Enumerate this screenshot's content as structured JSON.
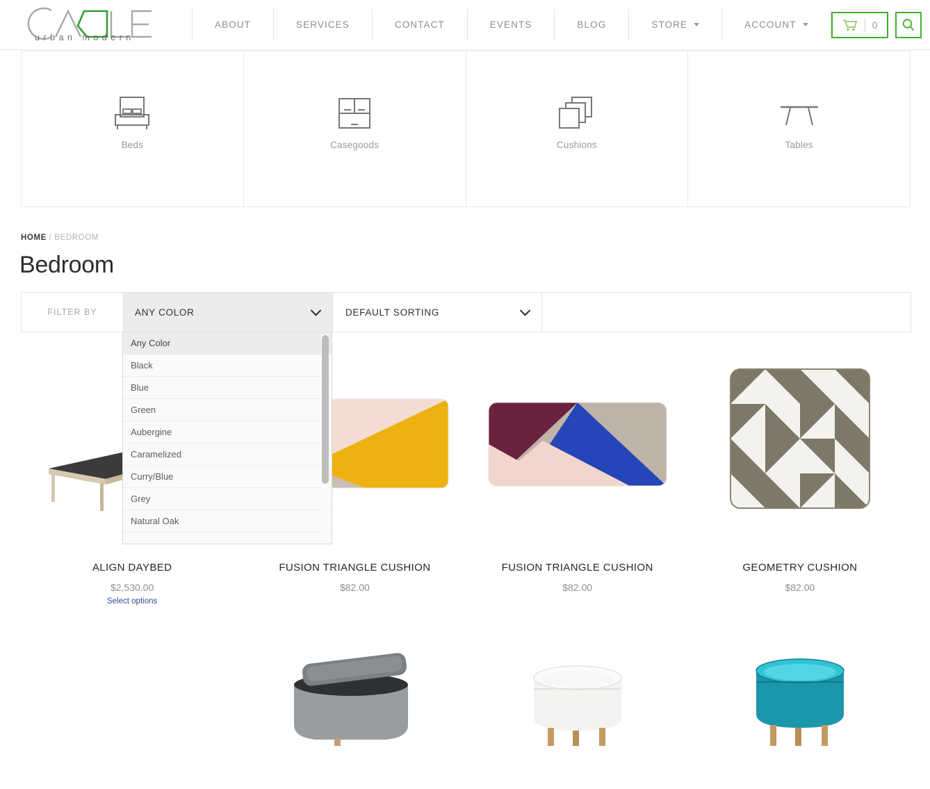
{
  "header": {
    "logo": {
      "main_text": "CA_LE",
      "letters": [
        "C",
        "A",
        "L",
        "E"
      ],
      "tagline": "urban modern",
      "accent_color": "#2f9e36"
    },
    "nav": [
      {
        "label": "ABOUT",
        "has_dropdown": false
      },
      {
        "label": "SERVICES",
        "has_dropdown": false
      },
      {
        "label": "CONTACT",
        "has_dropdown": false
      },
      {
        "label": "EVENTS",
        "has_dropdown": false
      },
      {
        "label": "BLOG",
        "has_dropdown": false
      },
      {
        "label": "STORE",
        "has_dropdown": true
      },
      {
        "label": "ACCOUNT",
        "has_dropdown": true
      }
    ],
    "cart": {
      "icon": "shopping-cart-icon",
      "count": "0",
      "border_color": "#3fae2a"
    },
    "search": {
      "icon": "search-icon",
      "border_color": "#3fae2a"
    }
  },
  "categories": [
    {
      "label": "Beds",
      "icon": "bed-icon"
    },
    {
      "label": "Casegoods",
      "icon": "cabinet-icon"
    },
    {
      "label": "Cushions",
      "icon": "stacked-squares-icon"
    },
    {
      "label": "Tables",
      "icon": "table-icon"
    }
  ],
  "breadcrumb": {
    "home": "HOME",
    "separator": "/",
    "current": "BEDROOM"
  },
  "page_title": "Bedroom",
  "filter_bar": {
    "filter_by_label": "FILTER BY",
    "color_select_value": "ANY COLOR",
    "sort_select_value": "DEFAULT SORTING"
  },
  "color_dropdown": {
    "open": true,
    "options": [
      "Any Color",
      "Black",
      "Blue",
      "Green",
      "Aubergine",
      "Caramelized",
      "Curry/Blue",
      "Grey",
      "Natural Oak"
    ],
    "selected": "Any Color"
  },
  "products_row1": [
    {
      "title": "ALIGN DAYBED",
      "price": "$2,530.00",
      "action_link": "Select options",
      "image": "daybed-image"
    },
    {
      "title": "FUSION TRIANGLE CUSHION",
      "price": "$82.00",
      "action_link": "",
      "image": "fusion-cushion-yellow-image"
    },
    {
      "title": "FUSION TRIANGLE CUSHION",
      "price": "$82.00",
      "action_link": "",
      "image": "fusion-cushion-blue-image"
    },
    {
      "title": "GEOMETRY CUSHION",
      "price": "$82.00",
      "action_link": "",
      "image": "geometry-cushion-image"
    }
  ],
  "products_row2": [
    {
      "image": "empty-slot"
    },
    {
      "image": "grey-storage-table-image"
    },
    {
      "image": "white-round-table-image"
    },
    {
      "image": "teal-round-table-image"
    }
  ]
}
